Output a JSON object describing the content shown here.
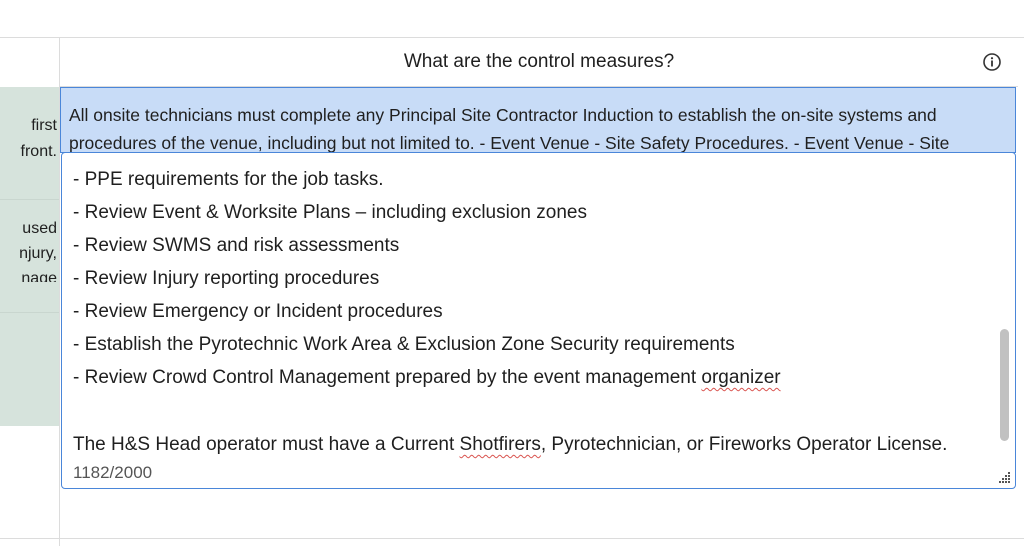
{
  "table": {
    "header": "What are the control measures?",
    "left_cells": [
      {
        "lines": [
          "first",
          "front."
        ]
      },
      {
        "lines": [
          "used",
          "njury,",
          "nage"
        ]
      },
      {
        "lines": []
      }
    ],
    "selected_cell_text": "All onsite technicians must complete any Principal Site Contractor Induction to establish the on-site systems and procedures of the venue, including but not limited to. - Event Venue - Site Safety Procedures. - Event Venue - Site"
  },
  "editor": {
    "lines": [
      "- PPE requirements for the job tasks.",
      "- Review Event & Worksite Plans – including exclusion zones",
      "- Review SWMS and risk assessments",
      "- Review Injury reporting procedures",
      "- Review Emergency or Incident procedures",
      "- Establish the Pyrotechnic Work Area & Exclusion Zone Security requirements"
    ],
    "crowd_line_prefix": "- Review Crowd Control Management prepared by the event management ",
    "crowd_line_misspelled": "organizer",
    "license_prefix": "The H&S Head operator must have a Current ",
    "license_misspelled": "Shotfirers",
    "license_suffix": ", Pyrotechnician, or Fireworks Operator License.",
    "char_count": "1182/2000"
  },
  "icons": {
    "info": "info-circle-icon",
    "resize": "resize-handle-icon"
  },
  "colors": {
    "selection": "#c8dcf7",
    "focus_border": "#4a86d9",
    "left_fill": "#d6e3dc",
    "spellcheck": "#d9534f"
  }
}
